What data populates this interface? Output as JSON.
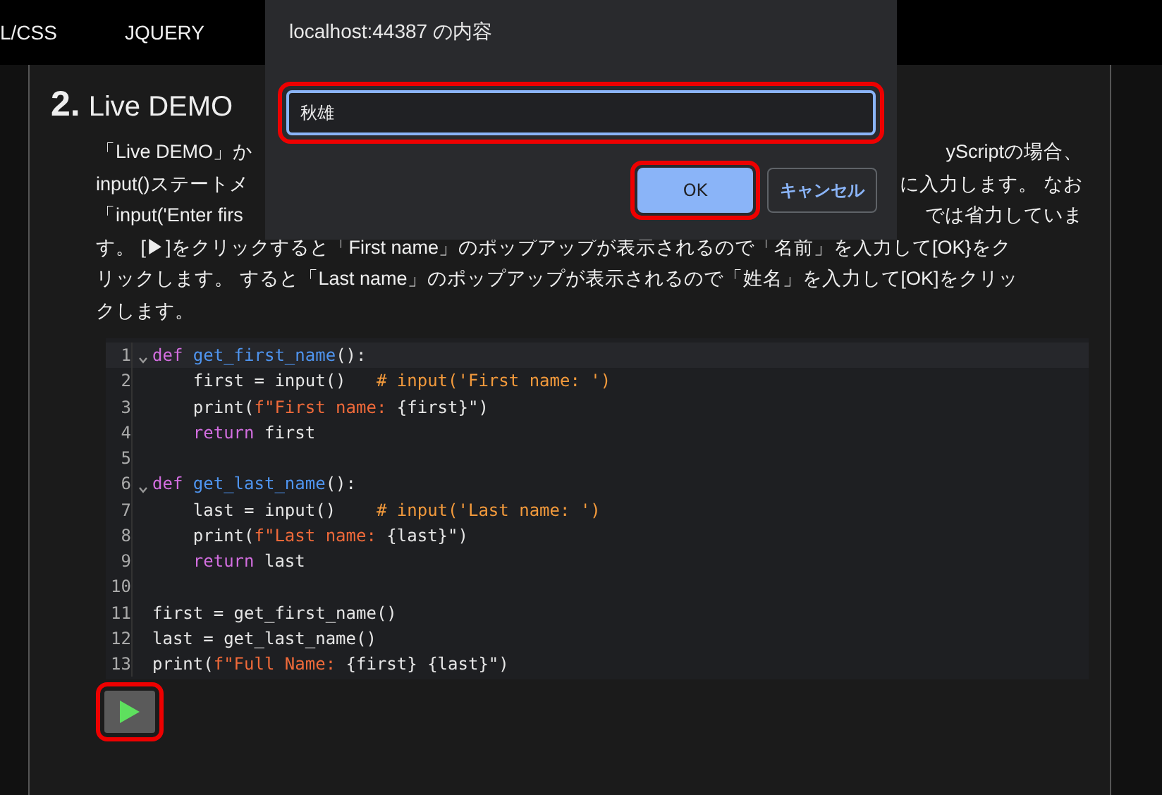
{
  "nav": [
    "L/CSS",
    "JQUERY"
  ],
  "section": {
    "number": "2.",
    "title": "Live DEMO"
  },
  "paragraph": [
    {
      "left": "「Live DEMO」か",
      "right": "yScriptの場合、"
    },
    {
      "left": "input()ステートメ",
      "right": "に入力します。 なお"
    },
    {
      "left": "「input('Enter firs",
      "right": "では省力していま"
    },
    {
      "text": "す。 [▶]をクリックすると「First name」のポップアップが表示されるので「名前」を入力して[OK}をク"
    },
    {
      "text": "リックします。 すると「Last name」のポップアップが表示されるので「姓名」を入力して[OK]をクリッ"
    },
    {
      "text": "クします。"
    }
  ],
  "code": [
    {
      "number": "1",
      "foldable": true,
      "active": true,
      "tokens": [
        {
          "kind": "kw",
          "text": "def "
        },
        {
          "kind": "fn",
          "text": "get_first_name"
        },
        {
          "kind": "plain",
          "text": "():"
        }
      ]
    },
    {
      "number": "2",
      "foldable": false,
      "active": false,
      "tokens": [
        {
          "kind": "plain",
          "text": "    first = input()   "
        },
        {
          "kind": "comment",
          "text": "# input('First name: ')"
        }
      ]
    },
    {
      "number": "3",
      "foldable": false,
      "active": false,
      "tokens": [
        {
          "kind": "plain",
          "text": "    print("
        },
        {
          "kind": "str",
          "text": "f\"First name: "
        },
        {
          "kind": "plain",
          "text": "{first}\")"
        }
      ]
    },
    {
      "number": "4",
      "foldable": false,
      "active": false,
      "tokens": [
        {
          "kind": "kw",
          "text": "    return"
        },
        {
          "kind": "plain",
          "text": " first"
        }
      ]
    },
    {
      "number": "5",
      "foldable": false,
      "active": false
    },
    {
      "number": "6",
      "foldable": true,
      "active": false,
      "tokens": [
        {
          "kind": "kw",
          "text": "def "
        },
        {
          "kind": "fn",
          "text": "get_last_name"
        },
        {
          "kind": "plain",
          "text": "():"
        }
      ]
    },
    {
      "number": "7",
      "foldable": false,
      "active": false,
      "tokens": [
        {
          "kind": "plain",
          "text": "    last = input()    "
        },
        {
          "kind": "comment",
          "text": "# input('Last name: ')"
        }
      ]
    },
    {
      "number": "8",
      "foldable": false,
      "active": false,
      "tokens": [
        {
          "kind": "plain",
          "text": "    print("
        },
        {
          "kind": "str",
          "text": "f\"Last name: "
        },
        {
          "kind": "plain",
          "text": "{last}\")"
        }
      ]
    },
    {
      "number": "9",
      "foldable": false,
      "active": false,
      "tokens": [
        {
          "kind": "kw",
          "text": "    return"
        },
        {
          "kind": "plain",
          "text": " last"
        }
      ]
    },
    {
      "number": "10",
      "foldable": false,
      "active": false
    },
    {
      "number": "11",
      "foldable": false,
      "active": false,
      "tokens": [
        {
          "kind": "plain",
          "text": "first = get_first_name()"
        }
      ]
    },
    {
      "number": "12",
      "foldable": false,
      "active": false,
      "tokens": [
        {
          "kind": "plain",
          "text": "last = get_last_name()"
        }
      ]
    },
    {
      "number": "13",
      "foldable": false,
      "active": false,
      "tokens": [
        {
          "kind": "plain",
          "text": "print("
        },
        {
          "kind": "str",
          "text": "f\"Full Name: "
        },
        {
          "kind": "plain",
          "text": "{first} {last}\")"
        }
      ]
    }
  ],
  "run_button": {
    "highlighted": true
  },
  "dialog": {
    "title": "localhost:44387 の内容",
    "input": {
      "value": "秋雄",
      "highlighted": true
    },
    "buttons": [
      {
        "label": "OK",
        "kind": "primary",
        "highlighted": true
      },
      {
        "label": "キャンセル",
        "kind": "secondary",
        "highlighted": false
      }
    ]
  }
}
